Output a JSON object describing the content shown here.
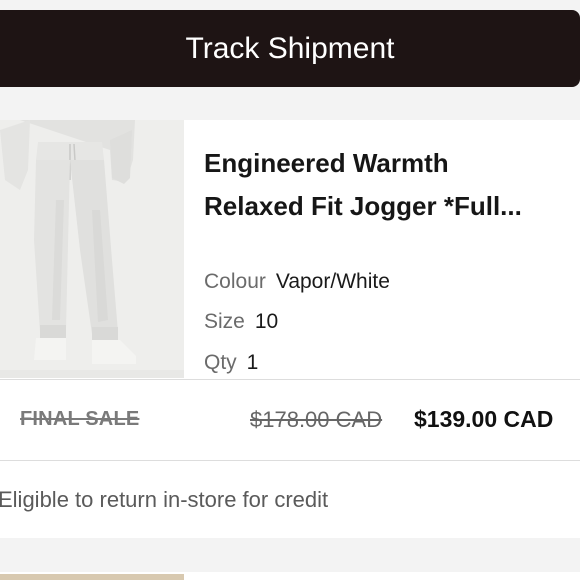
{
  "header": {
    "track_label": "Track Shipment"
  },
  "item": {
    "name": "Engineered Warmth Relaxed Fit Jogger *Full...",
    "name_line1": "Engineered Warmth",
    "name_line2": "Relaxed Fit Jogger *Full...",
    "image_icon": "product-photo",
    "attributes": {
      "colour_label": "Colour",
      "colour_value": "Vapor/White",
      "size_label": "Size",
      "size_value": "10",
      "qty_label": "Qty",
      "qty_value": "1"
    },
    "final_sale_label": "FINAL SALE",
    "original_price": "$178.00 CAD",
    "sale_price": "$139.00 CAD",
    "return_policy": "Eligible to return in-store for credit"
  },
  "colors": {
    "button_bg": "#1e1414",
    "card_bg": "#ffffff",
    "page_bg": "#f3f3f3"
  }
}
